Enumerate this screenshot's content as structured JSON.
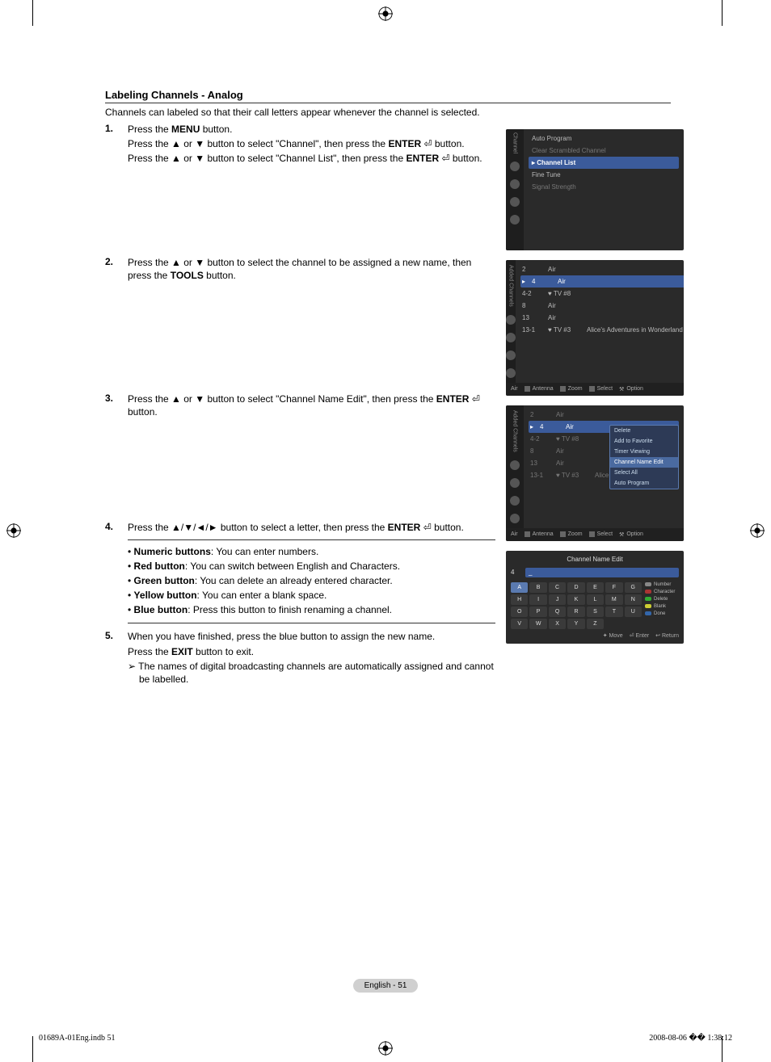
{
  "heading": "Labeling Channels - Analog",
  "intro": "Channels can labeled so that their call letters appear whenever the channel is selected.",
  "steps": {
    "s1": {
      "num": "1.",
      "l1a": "Press the ",
      "l1b": "MENU",
      "l1c": " button.",
      "l2a": "Press the ▲ or ▼ button to select \"Channel\", then press the ",
      "l2b": "ENTER",
      "l2c": " ",
      "l2d": "button.",
      "l3a": "Press the ▲ or ▼ button to select \"Channel List\", then press the ",
      "l3b": "ENTER",
      "l3c": " ",
      "l3d": "button."
    },
    "s2": {
      "num": "2.",
      "l1a": "Press the ▲ or ▼ button to select the channel to be assigned a new name, then press the ",
      "l1b": "TOOLS",
      "l1c": " button."
    },
    "s3": {
      "num": "3.",
      "l1a": "Press the ▲ or ▼ button to select \"Channel Name Edit\", then press the ",
      "l1b": "ENTER",
      "l1c": " ",
      "l1d": " button."
    },
    "s4": {
      "num": "4.",
      "l1a": "Press the ▲/▼/◄/► button to select a letter, then press the ",
      "l1b": "ENTER",
      "l1c": " ",
      "l1d": "button.",
      "b1a": "Numeric buttons",
      "b1b": ": You can enter numbers.",
      "b2a": "Red button",
      "b2b": ": You can switch between English and Characters.",
      "b3a": "Green button",
      "b3b": ": You can delete an already entered character.",
      "b4a": "Yellow button",
      "b4b": ": You can enter a blank space.",
      "b5a": "Blue button",
      "b5b": ": Press this button to finish renaming a channel."
    },
    "s5": {
      "num": "5.",
      "l1": "When you have finished, press the blue button to assign the new name.",
      "l2a": "Press the ",
      "l2b": "EXIT",
      "l2c": " button to exit.",
      "note": "The names of digital broadcasting channels are automatically assigned and cannot be labelled."
    }
  },
  "screen1": {
    "side": "Channel",
    "items": [
      "Auto Program",
      "Clear Scrambled Channel",
      "Channel List",
      "Fine Tune",
      "Signal Strength"
    ]
  },
  "screen2": {
    "side": "Added Channels",
    "rows": [
      {
        "n": "2",
        "name": "Air",
        "desc": ""
      },
      {
        "n": "4",
        "name": "Air",
        "desc": ""
      },
      {
        "n": "4-2",
        "name": "♥ TV #8",
        "desc": ""
      },
      {
        "n": "8",
        "name": "Air",
        "desc": ""
      },
      {
        "n": "13",
        "name": "Air",
        "desc": ""
      },
      {
        "n": "13-1",
        "name": "♥ TV #3",
        "desc": "Alice's Adventures in Wonderland"
      }
    ],
    "foot": {
      "src": "Air",
      "antenna": "Antenna",
      "zoom": "Zoom",
      "select": "Select",
      "option": "Option"
    }
  },
  "screen3": {
    "side": "Added Channels",
    "rows": [
      {
        "n": "2",
        "name": "Air",
        "desc": ""
      },
      {
        "n": "4",
        "name": "Air",
        "desc": ""
      },
      {
        "n": "4-2",
        "name": "♥ TV #8",
        "desc": ""
      },
      {
        "n": "8",
        "name": "Air",
        "desc": ""
      },
      {
        "n": "13",
        "name": "Air",
        "desc": ""
      },
      {
        "n": "13-1",
        "name": "♥ TV #3",
        "desc": "Alice"
      }
    ],
    "menu": [
      "Delete",
      "Add to Favorite",
      "Timer Viewing",
      "Channel Name Edit",
      "Select All",
      "Auto Program"
    ],
    "foot": {
      "src": "Air",
      "antenna": "Antenna",
      "zoom": "Zoom",
      "select": "Select",
      "option": "Option"
    }
  },
  "screen4": {
    "title": "Channel Name Edit",
    "ch": "4",
    "val": "_",
    "keys": [
      "A",
      "B",
      "C",
      "D",
      "E",
      "F",
      "G",
      "H",
      "I",
      "J",
      "K",
      "L",
      "M",
      "N",
      "O",
      "P",
      "Q",
      "R",
      "S",
      "T",
      "U",
      "V",
      "W",
      "X",
      "Y",
      "Z"
    ],
    "legend": [
      {
        "color": "#888",
        "label": "Number"
      },
      {
        "color": "#a33",
        "label": "Character"
      },
      {
        "color": "#3a3",
        "label": "Delete"
      },
      {
        "color": "#cc3",
        "label": "Blank"
      },
      {
        "color": "#36a",
        "label": "Done"
      }
    ],
    "foot": {
      "move": "Move",
      "enter": "Enter",
      "return": "Return"
    }
  },
  "footer": "English - 51",
  "print": {
    "left": "01689A-01Eng.indb   51",
    "right": "2008-08-06   �� 1:38:12"
  }
}
